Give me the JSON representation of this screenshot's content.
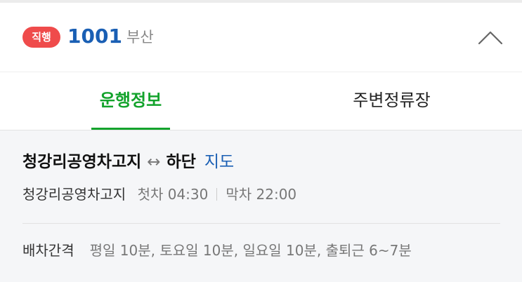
{
  "header": {
    "badge": "직행",
    "route_number": "1001",
    "region": "부산",
    "collapse_icon": "chevron-up-icon"
  },
  "tabs": [
    {
      "label": "운행정보",
      "active": true
    },
    {
      "label": "주변정류장",
      "active": false
    }
  ],
  "route": {
    "origin": "청강리공영차고지",
    "arrow": "↔",
    "destination": "하단",
    "map_link": "지도"
  },
  "schedule": {
    "stop": "청강리공영차고지",
    "first_bus": "첫차 04:30",
    "last_bus": "막차 22:00"
  },
  "interval": {
    "label": "배차간격",
    "value": "평일 10분, 토요일 10분, 일요일 10분, 출퇴근 6~7분"
  },
  "colors": {
    "badge": "#ef4b4b",
    "route_number": "#1a5fb4",
    "active_tab": "#13a32c",
    "link": "#1a5fb4"
  }
}
